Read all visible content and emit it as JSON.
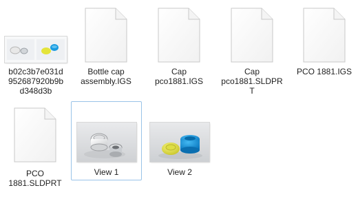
{
  "files": [
    {
      "name": "b02c3b7e031d952687920b9bd348d3b",
      "label": "b02c3b7e031d\n952687920b9b\nd348d3b",
      "icon": "image-thumbnail-icon",
      "selected": false
    },
    {
      "name": "Bottle cap assembly.IGS",
      "label": "Bottle cap\nassembly.IGS",
      "icon": "document-icon",
      "selected": false
    },
    {
      "name": "Cap pco1881.IGS",
      "label": "Cap\npco1881.IGS",
      "icon": "document-icon",
      "selected": false
    },
    {
      "name": "Cap pco1881.SLDPRT",
      "label": "Cap\npco1881.SLDPR\nT",
      "icon": "document-icon",
      "selected": false
    },
    {
      "name": "PCO 1881.IGS",
      "label": "PCO 1881.IGS",
      "icon": "document-icon",
      "selected": false
    },
    {
      "name": "PCO 1881.SLDPRT",
      "label": "PCO\n1881.SLDPRT",
      "icon": "document-icon",
      "selected": false
    },
    {
      "name": "View 1",
      "label": "View 1",
      "icon": "image-thumbnail-icon",
      "selected": true
    },
    {
      "name": "View 2",
      "label": "View 2",
      "icon": "image-thumbnail-icon",
      "selected": false
    }
  ],
  "colors": {
    "selection_border": "#99c3e8",
    "cap_blue": "#1a9be0",
    "cap_yellow": "#e0e040"
  }
}
